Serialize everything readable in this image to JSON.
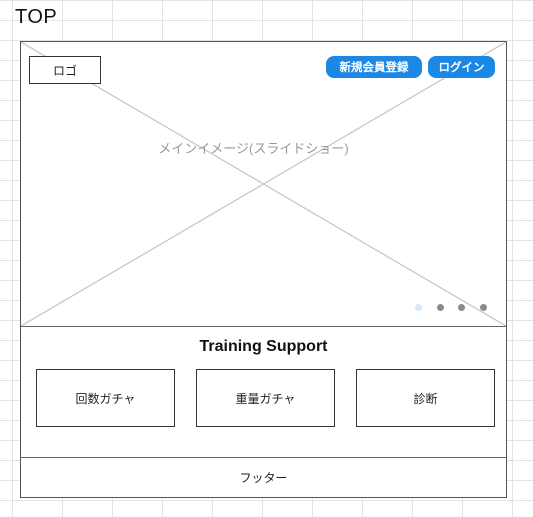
{
  "page": {
    "title": "TOP"
  },
  "header": {
    "logo_label": "ロゴ",
    "register_label": "新規会員登録",
    "login_label": "ログイン"
  },
  "hero": {
    "caption": "メインイメージ(スライドショー)",
    "slide_count": 4,
    "active_slide": 1
  },
  "section": {
    "title": "Training Support",
    "cards": [
      {
        "label": "回数ガチャ"
      },
      {
        "label": "重量ガチャ"
      },
      {
        "label": "診断"
      }
    ]
  },
  "footer": {
    "label": "フッター"
  },
  "colors": {
    "button": "#1b88e6",
    "dot_active": "#dbe9f7",
    "dot_inactive": "#8a8a8a",
    "cross_line": "#c4c4c4",
    "grid": "#e3e3e3"
  }
}
